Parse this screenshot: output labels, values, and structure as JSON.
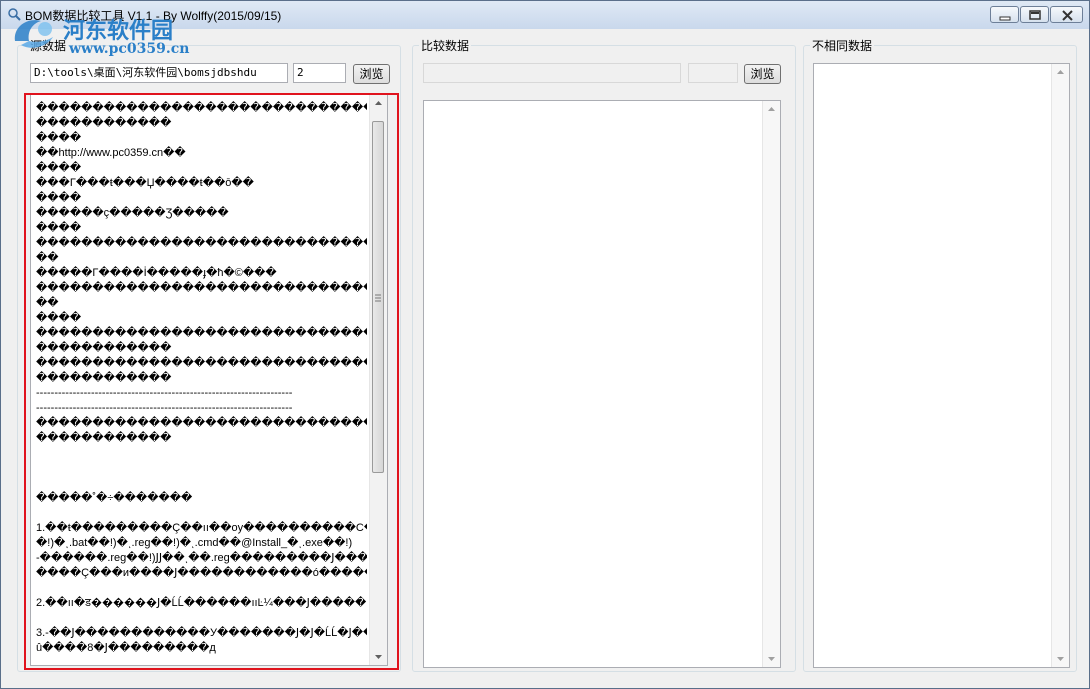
{
  "window": {
    "title": "BOM数据比较工具 V1.1 - By Wolffy(2015/09/15)"
  },
  "watermark": {
    "text": "河东软件园",
    "url": "www.pc0359.cn"
  },
  "source_panel": {
    "group_label": "源数据",
    "path_value": "D:\\tools\\桌面\\河东软件园\\bomsjdbshdu",
    "column_value": "2",
    "browse_label": "浏览",
    "lines": [
      "������������������������������������������������",
      "������������",
      "����",
      "��http://www.pc0359.cn��",
      "����",
      "���Γ���ŧ���Џ����ŧ��ō��",
      "����",
      "������ç�����Ʒ�����",
      "����",
      "������������������������������������������������",
      "��",
      "�����Γ����İ�����ɟ�ћ�©���",
      "������������������������������������������������",
      "��",
      "����",
      "������������������������������������������������",
      "������������",
      "������������������������������������������������",
      "������������",
      "----------------------------------------------------------------------",
      "----------------------------------------------------------------------",
      "������������������������������������������������",
      "������������",
      "",
      "",
      "",
      "�����˚�÷�������",
      "",
      "1.��ŧ���������Ç��ıı��oy����������C�@�ͺ�����.exe�",
      "�!)�ͺ.bat��!)�ͺ.reg��!)�ͺ.cmd��@Install_�ͺ.exe��!)",
      "-������.reg��!)ͿͿ��ͺ��.reg���������Ϳ���",
      "����Ç���и����Ϳ������������ó����������C�",
      "",
      "2.��ıı�ड������Ϳ�ĹĹ������ııĿ¼���Ϳ�����",
      "",
      "3.-��Ϳ������������У�������Ϳ�Ϳ�ĹĹ�Ϳ��Ϳ�Ϳ����Щ�����д�",
      "û����8�Ϳ���������д"
    ]
  },
  "compare_panel": {
    "group_label": "比较数据",
    "path_value": "",
    "column_value": "",
    "browse_label": "浏览"
  },
  "diff_panel": {
    "group_label": "不相同数据"
  }
}
